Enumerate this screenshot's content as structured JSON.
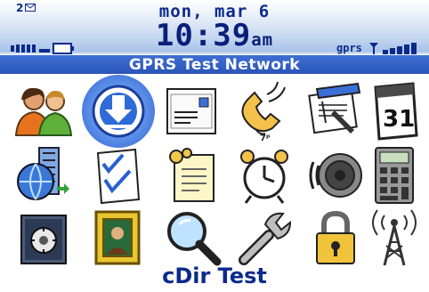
{
  "status": {
    "message_count": "2",
    "date": "mon, mar 6",
    "time": "10:39",
    "ampm": "am",
    "network_type": "gprs",
    "network_name": "GPRS Test Network"
  },
  "apps": [
    {
      "icon": "contacts-icon"
    },
    {
      "icon": "download-icon",
      "selected": true
    },
    {
      "icon": "messages-icon"
    },
    {
      "icon": "phone-icon"
    },
    {
      "icon": "memopad-icon"
    },
    {
      "icon": "calendar-icon",
      "label": "31"
    },
    {
      "icon": "browser-icon"
    },
    {
      "icon": "tasks-icon"
    },
    {
      "icon": "notes-icon"
    },
    {
      "icon": "alarm-clock-icon"
    },
    {
      "icon": "sound-profiles-icon"
    },
    {
      "icon": "calculator-icon"
    },
    {
      "icon": "safe-icon"
    },
    {
      "icon": "picture-frame-icon"
    },
    {
      "icon": "search-icon"
    },
    {
      "icon": "options-icon"
    },
    {
      "icon": "lock-icon"
    },
    {
      "icon": "tower-icon"
    }
  ],
  "selected_app_title": "cDir Test",
  "colors": {
    "banner_text": "#0b2a8c",
    "network_bar": "#2a54b8",
    "selection_ring": "#2c5fc9"
  }
}
